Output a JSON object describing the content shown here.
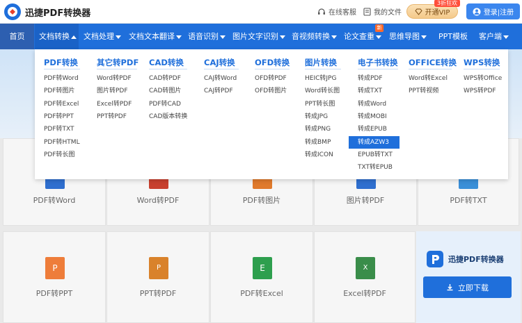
{
  "header": {
    "brand": "迅捷PDF转换器",
    "help": "在线客服",
    "files": "我的文件",
    "vip_label": "开通VIP",
    "vip_badge": "3折狂欢",
    "login_label": "登录|注册"
  },
  "nav": {
    "items": [
      {
        "label": "首页"
      },
      {
        "label": "文档转换"
      },
      {
        "label": "文档处理"
      },
      {
        "label": "文档文本翻译"
      },
      {
        "label": "语音识别"
      },
      {
        "label": "图片文字识别"
      },
      {
        "label": "音视频转换"
      },
      {
        "label": "论文查重"
      },
      {
        "label": "思维导图"
      },
      {
        "label": "PPT模板"
      },
      {
        "label": "客户端"
      }
    ],
    "new_badge": "新"
  },
  "dropdown": {
    "columns": [
      {
        "title": "PDF转换",
        "items": [
          "PDF转Word",
          "PDF转图片",
          "PDF转Excel",
          "PDF转PPT",
          "PDF转TXT",
          "PDF转HTML",
          "PDF转长图"
        ]
      },
      {
        "title": "其它转PDF",
        "items": [
          "Word转PDF",
          "图片转PDF",
          "Excel转PDF",
          "PPT转PDF"
        ]
      },
      {
        "title": "CAD转换",
        "items": [
          "CAD转PDF",
          "CAD转图片",
          "PDF转CAD",
          "CAD版本转换"
        ]
      },
      {
        "title": "CAJ转换",
        "items": [
          "CAJ转Word",
          "CAJ转PDF"
        ]
      },
      {
        "title": "OFD转换",
        "items": [
          "OFD转PDF",
          "OFD转图片"
        ]
      },
      {
        "title": "图片转换",
        "items": [
          "HEIC转JPG",
          "Word转长图",
          "PPT转长图",
          "转成JPG",
          "转成PNG",
          "转成BMP",
          "转成ICON"
        ]
      },
      {
        "title": "电子书转换",
        "items": [
          "转成PDF",
          "转成TXT",
          "转成Word",
          "转成MOBI",
          "转成EPUB",
          "转成AZW3",
          "EPUB转TXT",
          "TXT转EPUB"
        ],
        "selected": 5
      },
      {
        "title": "OFFICE转换",
        "items": [
          "Word转Excel",
          "PPT转视频"
        ]
      },
      {
        "title": "WPS转换",
        "items": [
          "WPS转Office",
          "WPS转PDF"
        ]
      }
    ]
  },
  "cards_row1": [
    "PDF转Word",
    "Word转PDF",
    "PDF转图片",
    "图片转PDF",
    "PDF转TXT"
  ],
  "cards_row2": [
    {
      "label": "PDF转PPT",
      "icon": "P",
      "color": "#ee7d3a"
    },
    {
      "label": "PPT转PDF",
      "icon": "P",
      "color": "#d9822b"
    },
    {
      "label": "PDF转Excel",
      "icon": "E",
      "color": "#2e9f4e"
    },
    {
      "label": "Excel转PDF",
      "icon": "X",
      "color": "#3a8d4a"
    }
  ],
  "side": {
    "brand": "迅捷PDF转换器",
    "download_label": "立即下载"
  },
  "colors": {
    "nav_bg": "#1f6fdb",
    "accent": "#1f6fdb",
    "vip_gold": "#f4c98a"
  }
}
